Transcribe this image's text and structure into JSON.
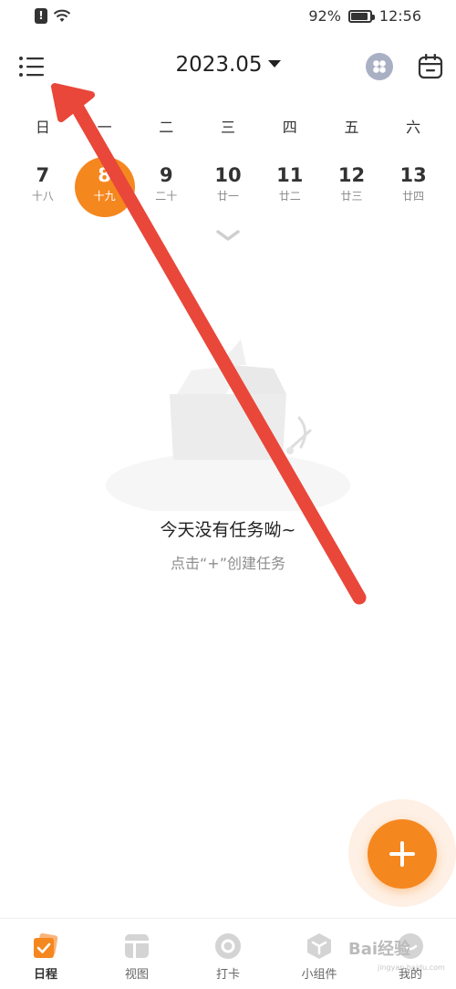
{
  "status_bar": {
    "battery_percent": "92%",
    "battery_level": 0.92,
    "time": "12:56",
    "icons": [
      "sim-alert-icon",
      "wifi-icon",
      "battery-icon"
    ]
  },
  "header": {
    "month": "2023.05",
    "icons": [
      "menu-icon",
      "dropdown-caret-icon",
      "view-switch-icon",
      "calendar-icon"
    ]
  },
  "week": {
    "weekdays": [
      "日",
      "一",
      "二",
      "三",
      "四",
      "五",
      "六"
    ],
    "dates": [
      {
        "day": "7",
        "lunar": "十八"
      },
      {
        "day": "8",
        "lunar": "十九"
      },
      {
        "day": "9",
        "lunar": "二十"
      },
      {
        "day": "10",
        "lunar": "廿一"
      },
      {
        "day": "11",
        "lunar": "廿二"
      },
      {
        "day": "12",
        "lunar": "廿三"
      },
      {
        "day": "13",
        "lunar": "廿四"
      }
    ],
    "selected_index": 1
  },
  "empty_state": {
    "title": "今天没有任务呦~",
    "subtitle": "点击“+”创建任务"
  },
  "fab": {
    "icon": "plus-icon"
  },
  "bottom_nav": {
    "items": [
      {
        "label": "日程",
        "icon": "schedule-icon",
        "active": true
      },
      {
        "label": "视图",
        "icon": "view-icon",
        "active": false
      },
      {
        "label": "打卡",
        "icon": "checkin-icon",
        "active": false
      },
      {
        "label": "小组件",
        "icon": "widget-icon",
        "active": false
      },
      {
        "label": "我的",
        "icon": "profile-icon",
        "active": false
      }
    ]
  },
  "watermark": {
    "text": "Bai经验",
    "sub": "jingyan.baidu.com"
  },
  "colors": {
    "accent": "#f5871f",
    "annotation_arrow": "#e8473a",
    "view_button": "#aab0c4"
  }
}
